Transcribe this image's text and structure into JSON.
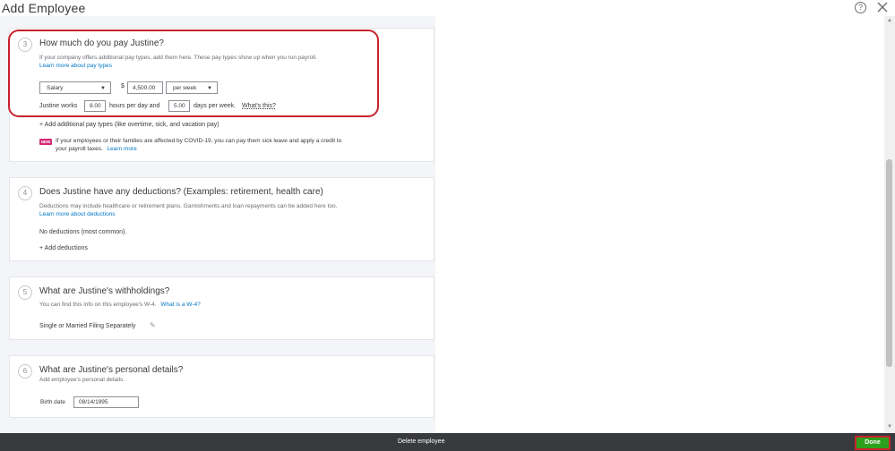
{
  "header": {
    "title": "Add Employee",
    "help_glyph": "?"
  },
  "pay": {
    "step": "3",
    "title": "How much do you pay Justine?",
    "desc": "If your company offers additional pay types, add them here. These pay types show up when you run payroll.",
    "learn_more": "Learn more about pay types",
    "pay_type": "Salary",
    "currency": "$",
    "amount": "4,500.00",
    "period": "per week",
    "works_label": "Justine works",
    "hours": "8.00",
    "hours_label": "hours per day and",
    "days": "5.00",
    "days_label": "days per week.",
    "whats_this": "What's this?",
    "add_pay_types": "+ Add additional pay types (like overtime, sick, and vacation pay)",
    "new_badge": "NEW",
    "covid_line1": "If your employees or their families are affected by COVID-19, you can pay them sick leave and apply a credit to",
    "covid_line2": "your payroll taxes.",
    "covid_learn_more": "Learn more"
  },
  "deductions": {
    "step": "4",
    "title": "Does Justine have any deductions? (Examples: retirement, health care)",
    "desc": "Deductions may include healthcare or retirement plans. Garnishments and loan repayments can be added here too.",
    "learn_more": "Learn more about deductions",
    "none_text": "No deductions (most common).",
    "add_link": "+ Add deductions"
  },
  "withholdings": {
    "step": "5",
    "title": "What are Justine's withholdings?",
    "desc": "You can find this info on this employee's W-4.",
    "what_is_w4": "What is a W-4?",
    "filing_status": "Single or Married Filing Separately"
  },
  "personal": {
    "step": "6",
    "title": "What are Justine's personal details?",
    "desc": "Add employee's personal details.",
    "birth_label": "Birth date",
    "birth_value": "08/14/1995"
  },
  "footer": {
    "delete": "Delete employee",
    "done": "Done"
  },
  "colors": {
    "link": "#0077c5",
    "done": "#2ca01c",
    "highlight": "#c8232c",
    "new_badge": "#d52b76",
    "footer": "#393a3d"
  }
}
